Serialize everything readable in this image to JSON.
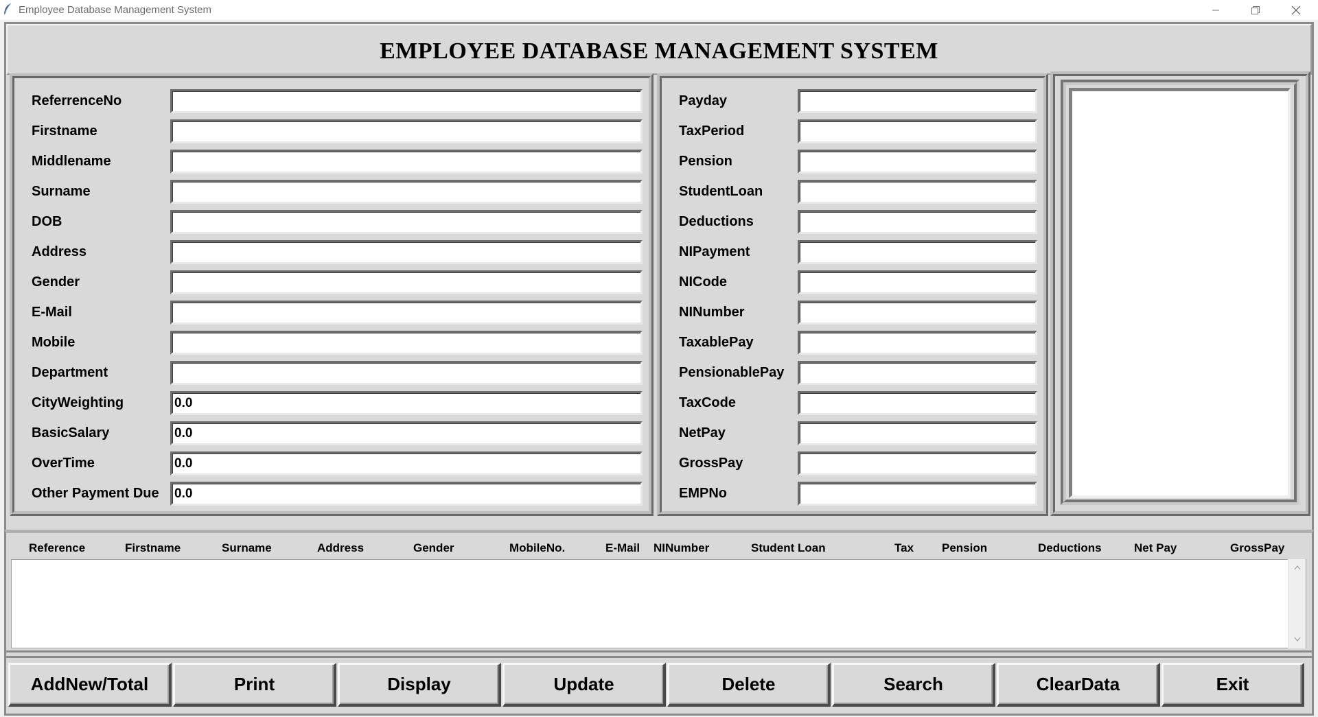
{
  "window": {
    "title": "Employee Database Management System",
    "icon": "feather-icon",
    "controls": [
      "minimize-icon",
      "restore-icon",
      "close-icon"
    ]
  },
  "header": {
    "title": "EMPLOYEE DATABASE MANAGEMENT SYSTEM"
  },
  "left_fields": [
    {
      "label": "ReferrenceNo",
      "value": ""
    },
    {
      "label": "Firstname",
      "value": ""
    },
    {
      "label": "Middlename",
      "value": ""
    },
    {
      "label": "Surname",
      "value": ""
    },
    {
      "label": "DOB",
      "value": ""
    },
    {
      "label": "Address",
      "value": ""
    },
    {
      "label": "Gender",
      "value": ""
    },
    {
      "label": "E-Mail",
      "value": ""
    },
    {
      "label": "Mobile",
      "value": ""
    },
    {
      "label": "Department",
      "value": ""
    },
    {
      "label": "CityWeighting",
      "value": "0.0"
    },
    {
      "label": "BasicSalary",
      "value": "0.0"
    },
    {
      "label": "OverTime",
      "value": "0.0"
    },
    {
      "label": "Other Payment Due",
      "value": "0.0"
    }
  ],
  "right_fields": [
    {
      "label": "Payday",
      "value": ""
    },
    {
      "label": "TaxPeriod",
      "value": ""
    },
    {
      "label": "Pension",
      "value": ""
    },
    {
      "label": "StudentLoan",
      "value": ""
    },
    {
      "label": "Deductions",
      "value": ""
    },
    {
      "label": "NIPayment",
      "value": ""
    },
    {
      "label": "NICode",
      "value": ""
    },
    {
      "label": "NINumber",
      "value": ""
    },
    {
      "label": "TaxablePay",
      "value": ""
    },
    {
      "label": "PensionablePay",
      "value": ""
    },
    {
      "label": "TaxCode",
      "value": ""
    },
    {
      "label": "NetPay",
      "value": ""
    },
    {
      "label": "GrossPay",
      "value": ""
    },
    {
      "label": "EMPNo",
      "value": ""
    }
  ],
  "list": {
    "columns": [
      "Reference",
      "Firstname",
      "Surname",
      "Address",
      "Gender",
      "MobileNo.",
      "E-Mail",
      "NINumber",
      "Student Loan",
      "Tax",
      "Pension",
      "Deductions",
      "Net Pay",
      "GrossPay"
    ]
  },
  "buttons": [
    "AddNew/Total",
    "Print",
    "Display",
    "Update",
    "Delete",
    "Search",
    "ClearData",
    "Exit"
  ]
}
